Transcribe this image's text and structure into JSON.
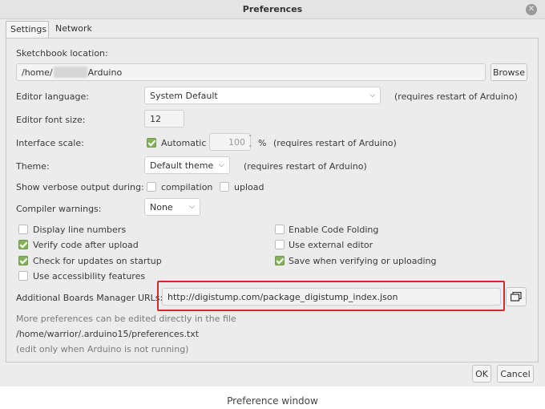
{
  "window": {
    "title": "Preferences",
    "close_glyph": "✕"
  },
  "tabs": [
    {
      "label": "Settings",
      "active": true
    },
    {
      "label": "Network",
      "active": false
    }
  ],
  "sketchbook": {
    "label": "Sketchbook location:",
    "path_prefix": "/home/",
    "path_suffix": "Arduino",
    "browse_label": "Browse"
  },
  "editor_language": {
    "label": "Editor language:",
    "value": "System Default",
    "note": "(requires restart of Arduino)"
  },
  "editor_font_size": {
    "label": "Editor font size:",
    "value": "12"
  },
  "interface_scale": {
    "label": "Interface scale:",
    "automatic_label": "Automatic",
    "automatic_checked": true,
    "value": "100",
    "unit": "%",
    "note": "(requires restart of Arduino)"
  },
  "theme": {
    "label": "Theme:",
    "value": "Default theme",
    "note": "(requires restart of Arduino)"
  },
  "verbose": {
    "label": "Show verbose output during:",
    "compilation_label": "compilation",
    "compilation_checked": false,
    "upload_label": "upload",
    "upload_checked": false
  },
  "compiler_warnings": {
    "label": "Compiler warnings:",
    "value": "None"
  },
  "options_left": [
    {
      "label": "Display line numbers",
      "checked": false
    },
    {
      "label": "Verify code after upload",
      "checked": true
    },
    {
      "label": "Check for updates on startup",
      "checked": true
    },
    {
      "label": "Use accessibility features",
      "checked": false
    }
  ],
  "options_right": [
    {
      "label": "Enable Code Folding",
      "checked": false
    },
    {
      "label": "Use external editor",
      "checked": false
    },
    {
      "label": "Save when verifying or uploading",
      "checked": true
    }
  ],
  "boards_manager": {
    "label": "Additional Boards Manager URLs:",
    "value": "http://digistump.com/package_digistump_index.json",
    "button_icon": "window-list-icon"
  },
  "info": {
    "line1": "More preferences can be edited directly in the file",
    "line2": "/home/warrior/.arduino15/preferences.txt",
    "line3": "(edit only when Arduino is not running)"
  },
  "footer": {
    "ok_label": "OK",
    "cancel_label": "Cancel"
  },
  "caption": "Preference window",
  "colors": {
    "checkbox_checked": "#86b15a",
    "highlight": "#d42a2a"
  }
}
